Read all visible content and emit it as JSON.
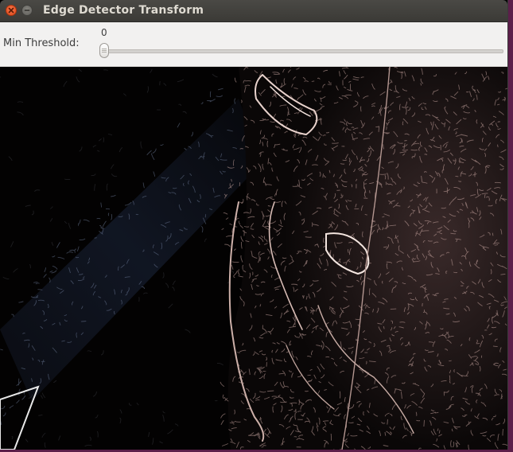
{
  "window": {
    "title": "Edge Detector Transform",
    "close_icon": "close-icon",
    "minimize_icon": "minimize-icon"
  },
  "trackbar": {
    "label": "Min Threshold:",
    "value": "0",
    "level": 0
  },
  "image": {
    "description_icon": "edge-detected-image",
    "edge_color_warm": "#c9a6a0",
    "edge_color_cool": "#6f7e9c",
    "background": "#030202"
  }
}
